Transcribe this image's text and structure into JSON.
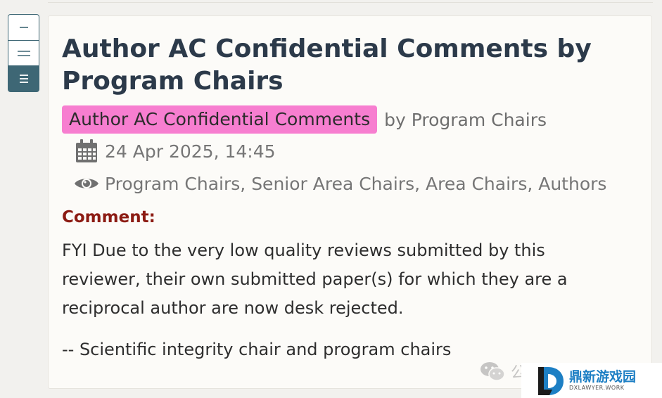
{
  "note": {
    "title": "Author AC Confidential Comments by Program Chairs",
    "invitation_badge": "Author AC Confidential Comments",
    "signature": "by Program Chairs",
    "date": "24 Apr 2025, 14:45",
    "readers": "Program Chairs, Senior Area Chairs, Area Chairs, Authors",
    "comment_label": "Comment:",
    "comment_paragraphs": [
      "FYI Due to the very low quality reviews submitted by this reviewer, their own submitted paper(s) for which they are a reciprocal author are now desk rejected.",
      "-- Scientific integrity chair and program chairs"
    ]
  },
  "view_toggle": {
    "icons": [
      "collapse-icon",
      "partial-expand-icon",
      "full-expand-icon"
    ],
    "active": "full-expand-icon"
  },
  "icons": {
    "date": "calendar-icon",
    "readers": "eye-icon"
  },
  "watermark": {
    "wechat_text": "公",
    "logo_cn": "鼎新游戏园",
    "logo_en": "DXLAWYER.WORK"
  },
  "colors": {
    "title": "#2c3a4a",
    "badge": "#f77ed0",
    "comment_label": "#8c1b13",
    "toggle_accent": "#3e6775"
  }
}
